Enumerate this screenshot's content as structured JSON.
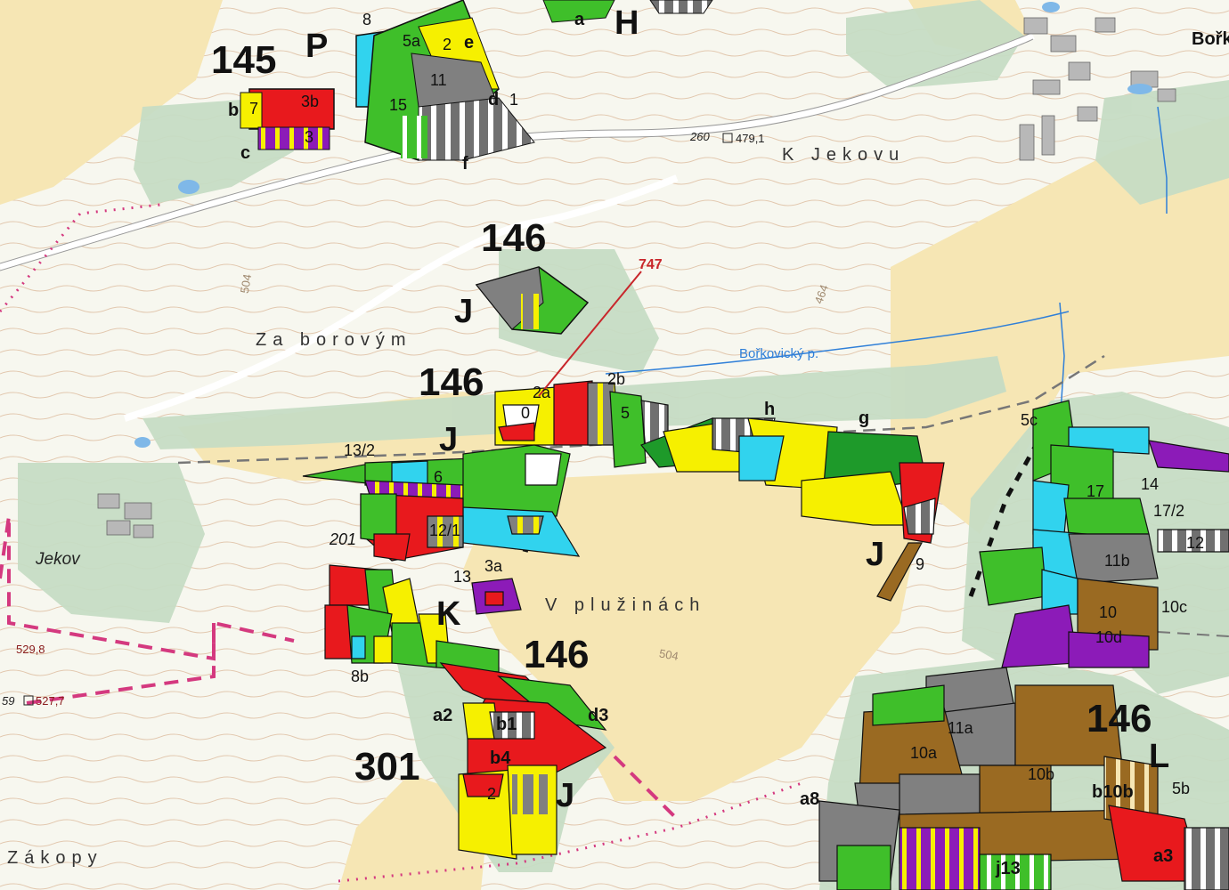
{
  "map": {
    "forest_units": [
      {
        "id": "u145",
        "text": "145"
      },
      {
        "id": "u146_top",
        "text": "146"
      },
      {
        "id": "u146_mid",
        "text": "146"
      },
      {
        "id": "u146_k",
        "text": "146"
      },
      {
        "id": "u146_l",
        "text": "146"
      },
      {
        "id": "u301",
        "text": "301"
      }
    ],
    "section_letters": [
      "P",
      "H",
      "J",
      "J",
      "J",
      "K",
      "L",
      "J"
    ],
    "place_names": [
      {
        "id": "za-borovym",
        "text": "Za borovým"
      },
      {
        "id": "k-jekovu",
        "text": "K Jekovu"
      },
      {
        "id": "v-pluzinach",
        "text": "V plužinách"
      },
      {
        "id": "zakopy",
        "text": "Zákopy"
      },
      {
        "id": "jekov",
        "text": "Jekov"
      },
      {
        "id": "borkovicky",
        "text": "Bořkovický p."
      },
      {
        "id": "bork",
        "text": "Bořk"
      }
    ],
    "elevations": [
      {
        "id": "e260",
        "text": "260"
      },
      {
        "id": "e479",
        "text": "479,1"
      },
      {
        "id": "e529",
        "text": "529,8"
      },
      {
        "id": "e59",
        "text": "59"
      },
      {
        "id": "e527",
        "text": "527,7"
      },
      {
        "id": "c504a",
        "text": "504"
      },
      {
        "id": "c464",
        "text": "464"
      },
      {
        "id": "c504b",
        "text": "504"
      }
    ],
    "callout": {
      "text": "747",
      "color": "#c8262b"
    },
    "parcel_labels": [
      "3b",
      "7",
      "3",
      "c",
      "b",
      "11",
      "2",
      "e",
      "5a",
      "15",
      "d",
      "f",
      "1",
      "8",
      "a",
      "2b",
      "0",
      "2a",
      "5",
      "h",
      "g",
      "13/2",
      "6",
      "12/1",
      "3a",
      "13",
      "201",
      "9",
      "5c",
      "17",
      "14",
      "17/2",
      "12",
      "11b",
      "10",
      "10c",
      "10d",
      "10a",
      "10b",
      "11a",
      "5b",
      "a3",
      "b4",
      "2",
      "b1",
      "d3",
      "a2",
      "8b",
      "a8",
      "b10b",
      "j13"
    ],
    "colors": {
      "background": "#f7f7ef",
      "field": "#f6e6b4",
      "forest_pale": "#c6dcc4",
      "green": "#3fbf2a",
      "dark_green": "#1e9a2a",
      "yellow": "#f6f000",
      "red": "#e8191d",
      "cyan": "#31d3ee",
      "gray": "#808080",
      "brown": "#9a6a22",
      "purple": "#8c1bb8",
      "magenta_boundary": "#d4397f",
      "contour": "#d8b89a",
      "stream": "#2f7fd8"
    }
  }
}
